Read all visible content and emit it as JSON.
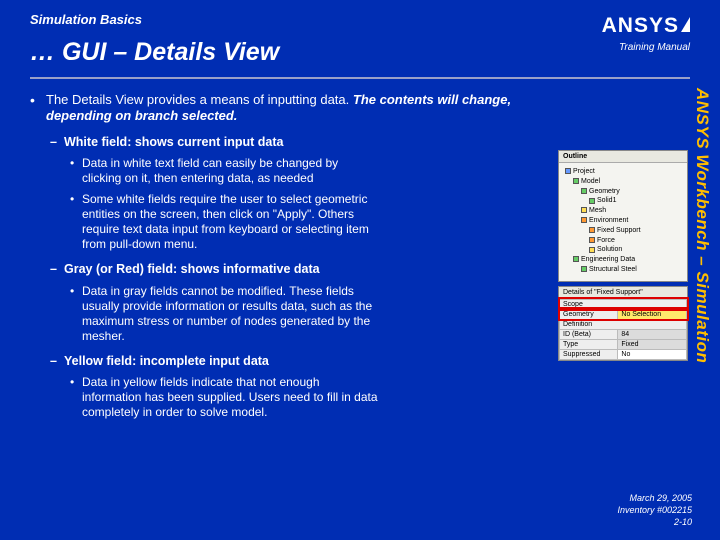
{
  "kicker": "Simulation Basics",
  "title": "… GUI – Details View",
  "logo": {
    "brand": "ANSYS",
    "sub": "Training Manual"
  },
  "sidetext": "ANSYS Workbench – Simulation",
  "bullets": {
    "b1a": "The Details View provides a means of inputting data.  ",
    "b1b": "The contents will change, depending on branch selected.",
    "b2_white": "White field: shows current input data",
    "b3_white_1": "Data in white text field can easily be changed by clicking on it, then entering data, as needed",
    "b3_white_2": "Some white fields require the user to select geometric entities on the screen, then click on \"Apply\".  Others require text data input from keyboard or selecting item from pull-down menu.",
    "b2_gray": "Gray (or Red) field: shows informative data",
    "b3_gray_1": "Data in gray fields cannot be modified.  These fields usually provide information or results data, such as the maximum stress or number of nodes generated by the mesher.",
    "b2_yellow": "Yellow field: incomplete input data",
    "b3_yellow_1": "Data in yellow fields indicate that not enough information has been supplied.  Users need to fill in data completely in order to solve model."
  },
  "footer": {
    "date": "March 29, 2005",
    "inv": "Inventory #002215",
    "page": "2-10"
  },
  "mock": {
    "outline_title": "Outline",
    "tree": {
      "project": "Project",
      "model": "Model",
      "geom": "Geometry",
      "solid1": "Solid1",
      "mesh": "Mesh",
      "env": "Environment",
      "fixed": "Fixed Support",
      "force": "Force",
      "sol": "Solution",
      "engdata": "Engineering Data",
      "steel": "Structural Steel"
    },
    "details_title": "Details of \"Fixed Support\"",
    "rows": {
      "scope_h": "Scope",
      "geom_l": "Geometry",
      "geom_v": "No Selection",
      "def_h": "Definition",
      "id_l": "ID (Beta)",
      "id_v": "84",
      "type_l": "Type",
      "type_v": "Fixed",
      "sup_l": "Suppressed",
      "sup_v": "No"
    }
  }
}
